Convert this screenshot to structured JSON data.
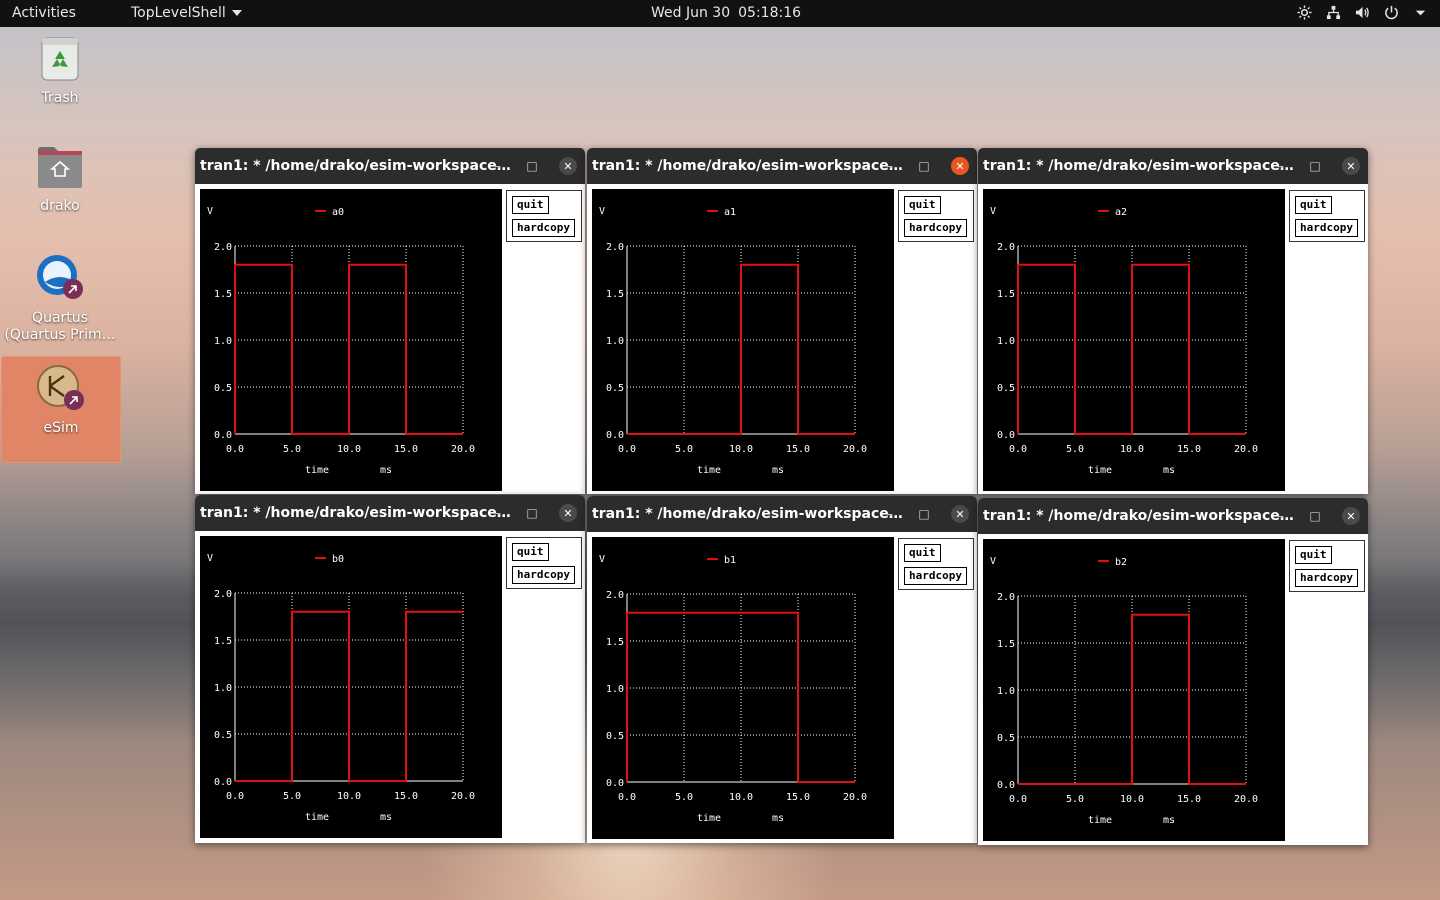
{
  "topbar": {
    "activities": "Activities",
    "app_menu": "TopLevelShell",
    "date": "Wed Jun 30",
    "time": "05:18:16",
    "tray_icons": [
      "brightness-icon",
      "network-icon",
      "volume-icon",
      "power-icon",
      "chevron-down-icon"
    ]
  },
  "desktop": {
    "icons": [
      {
        "label": "Trash",
        "icon": "trash-icon"
      },
      {
        "label": "drako",
        "icon": "home-folder-icon"
      },
      {
        "label": "Quartus\n(Quartus Prim…",
        "label1": "Quartus",
        "label2": "(Quartus Prim…",
        "icon": "quartus-icon"
      },
      {
        "label": "eSim",
        "icon": "esim-icon",
        "selected": true
      }
    ]
  },
  "colors": {
    "trace": "#e01010",
    "grid": "#ffffff",
    "plot_bg": "#000000",
    "close_active": "#e95420"
  },
  "windows": [
    {
      "title": "tran1: * /home/drako/esim-workspace…",
      "signal": "a0",
      "quit": "quit",
      "hardcopy": "hardcopy",
      "active": false
    },
    {
      "title": "tran1: * /home/drako/esim-workspace…",
      "signal": "a1",
      "quit": "quit",
      "hardcopy": "hardcopy",
      "active": true
    },
    {
      "title": "tran1: * /home/drako/esim-workspace…",
      "signal": "a2",
      "quit": "quit",
      "hardcopy": "hardcopy",
      "active": false
    },
    {
      "title": "tran1: * /home/drako/esim-workspace…",
      "signal": "b0",
      "quit": "quit",
      "hardcopy": "hardcopy",
      "active": false
    },
    {
      "title": "tran1: * /home/drako/esim-workspace…",
      "signal": "b1",
      "quit": "quit",
      "hardcopy": "hardcopy",
      "active": false
    },
    {
      "title": "tran1: * /home/drako/esim-workspace…",
      "signal": "b2",
      "quit": "quit",
      "hardcopy": "hardcopy",
      "active": false
    }
  ],
  "chart_data": [
    {
      "type": "line",
      "ylabel": "V",
      "xlabel": "time",
      "xunit": "ms",
      "xlim": [
        0,
        20
      ],
      "ylim": [
        0,
        2
      ],
      "xticks": [
        "0.0",
        "5.0",
        "10.0",
        "15.0",
        "20.0"
      ],
      "yticks": [
        "0.0",
        "0.5",
        "1.0",
        "1.5",
        "2.0"
      ],
      "grid": true,
      "series": [
        {
          "name": "a0",
          "x": [
            0,
            0,
            5,
            5,
            10,
            10,
            15,
            15,
            20
          ],
          "y": [
            0,
            1.8,
            1.8,
            0,
            0,
            1.8,
            1.8,
            0,
            0
          ]
        }
      ]
    },
    {
      "type": "line",
      "ylabel": "V",
      "xlabel": "time",
      "xunit": "ms",
      "xlim": [
        0,
        20
      ],
      "ylim": [
        0,
        2
      ],
      "xticks": [
        "0.0",
        "5.0",
        "10.0",
        "15.0",
        "20.0"
      ],
      "yticks": [
        "0.0",
        "0.5",
        "1.0",
        "1.5",
        "2.0"
      ],
      "grid": true,
      "series": [
        {
          "name": "a1",
          "x": [
            0,
            10,
            10,
            15,
            15,
            20
          ],
          "y": [
            0,
            0,
            1.8,
            1.8,
            0,
            0
          ]
        }
      ]
    },
    {
      "type": "line",
      "ylabel": "V",
      "xlabel": "time",
      "xunit": "ms",
      "xlim": [
        0,
        20
      ],
      "ylim": [
        0,
        2
      ],
      "xticks": [
        "0.0",
        "5.0",
        "10.0",
        "15.0",
        "20.0"
      ],
      "yticks": [
        "0.0",
        "0.5",
        "1.0",
        "1.5",
        "2.0"
      ],
      "grid": true,
      "series": [
        {
          "name": "a2",
          "x": [
            0,
            0,
            5,
            5,
            10,
            10,
            15,
            15,
            20
          ],
          "y": [
            0,
            1.8,
            1.8,
            0,
            0,
            1.8,
            1.8,
            0,
            0
          ]
        }
      ]
    },
    {
      "type": "line",
      "ylabel": "V",
      "xlabel": "time",
      "xunit": "ms",
      "xlim": [
        0,
        20
      ],
      "ylim": [
        0,
        2
      ],
      "xticks": [
        "0.0",
        "5.0",
        "10.0",
        "15.0",
        "20.0"
      ],
      "yticks": [
        "0.0",
        "0.5",
        "1.0",
        "1.5",
        "2.0"
      ],
      "grid": true,
      "series": [
        {
          "name": "b0",
          "x": [
            0,
            5,
            5,
            10,
            10,
            15,
            15,
            20
          ],
          "y": [
            0,
            0,
            1.8,
            1.8,
            0,
            0,
            1.8,
            1.8
          ]
        }
      ]
    },
    {
      "type": "line",
      "ylabel": "V",
      "xlabel": "time",
      "xunit": "ms",
      "xlim": [
        0,
        20
      ],
      "ylim": [
        0,
        2
      ],
      "xticks": [
        "0.0",
        "5.0",
        "10.0",
        "15.0",
        "20.0"
      ],
      "yticks": [
        "0.0",
        "0.5",
        "1.0",
        "1.5",
        "2.0"
      ],
      "grid": true,
      "series": [
        {
          "name": "b1",
          "x": [
            0,
            0,
            15,
            15,
            20
          ],
          "y": [
            0,
            1.8,
            1.8,
            0,
            0
          ]
        }
      ]
    },
    {
      "type": "line",
      "ylabel": "V",
      "xlabel": "time",
      "xunit": "ms",
      "xlim": [
        0,
        20
      ],
      "ylim": [
        0,
        2
      ],
      "xticks": [
        "0.0",
        "5.0",
        "10.0",
        "15.0",
        "20.0"
      ],
      "yticks": [
        "0.0",
        "0.5",
        "1.0",
        "1.5",
        "2.0"
      ],
      "grid": true,
      "series": [
        {
          "name": "b2",
          "x": [
            0,
            10,
            10,
            15,
            15,
            20
          ],
          "y": [
            0,
            0,
            1.8,
            1.8,
            0,
            0
          ]
        }
      ]
    }
  ]
}
